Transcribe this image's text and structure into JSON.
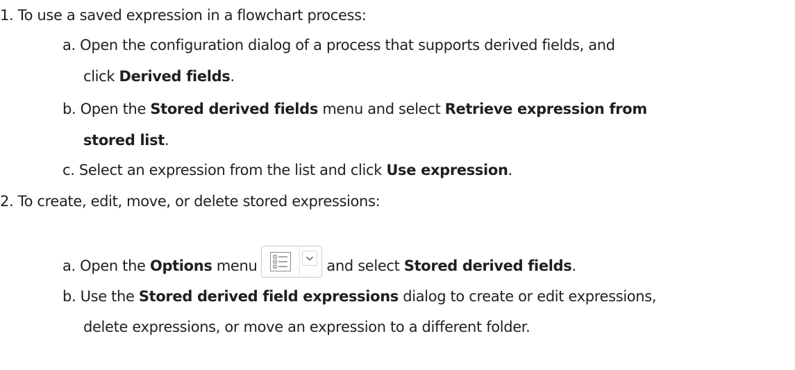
{
  "steps": {
    "s1": {
      "text": "1. To use a saved expression in a flowchart process:"
    },
    "s1a": {
      "prefix": "a. Open the configuration dialog of a process that supports derived fields, and",
      "cont_prefix": "click ",
      "bold1": "Derived fields",
      "cont_suffix": "."
    },
    "s1b": {
      "prefix": "b. Open the ",
      "bold1": "Stored derived fields",
      "middle": " menu and select ",
      "bold2": "Retrieve expression from",
      "bold2_cont": "stored list",
      "suffix": "."
    },
    "s1c": {
      "prefix": "c. Select an expression from the list and click ",
      "bold1": "Use expression",
      "suffix": "."
    },
    "s2": {
      "text": "2. To create, edit, move, or delete stored expressions:"
    },
    "s2a": {
      "prefix": "a. Open the ",
      "bold1": "Options",
      "middle": " menu",
      "after_icon": "and select ",
      "bold2": "Stored derived fields",
      "suffix": "."
    },
    "s2b": {
      "prefix": "b. Use the ",
      "bold1": "Stored derived field expressions",
      "suffix": " dialog to create or edit expressions,",
      "cont": "delete expressions, or move an expression to a different folder."
    }
  },
  "icons": {
    "options_menu": "list-icon",
    "dropdown": "chevron-down-icon"
  }
}
